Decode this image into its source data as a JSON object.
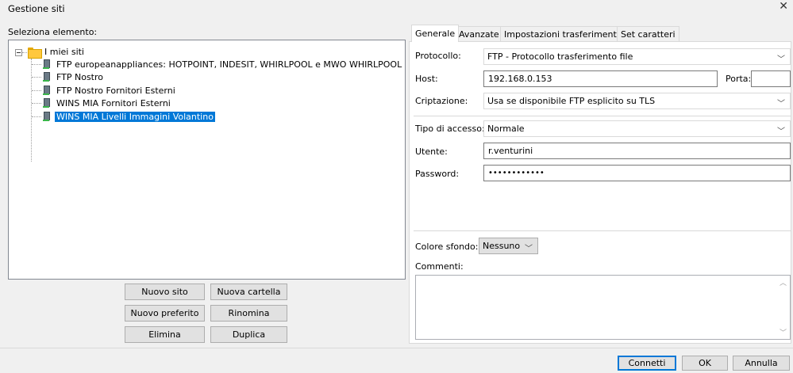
{
  "window": {
    "title": "Gestione siti",
    "close_glyph": "✕"
  },
  "tree": {
    "header": "Seleziona elemento:",
    "root_label": "I miei siti",
    "items": [
      {
        "label": "FTP europeanappliances: HOTPOINT, INDESIT, WHIRLPOOL e MWO WHIRLPOOL",
        "selected": false
      },
      {
        "label": "FTP Nostro",
        "selected": false
      },
      {
        "label": "FTP Nostro Fornitori Esterni",
        "selected": false
      },
      {
        "label": "WINS MIA Fornitori Esterni",
        "selected": false
      },
      {
        "label": "WINS MIA Livelli Immagini Volantino",
        "selected": true
      }
    ]
  },
  "buttons": {
    "new_site": "Nuovo sito",
    "new_folder": "Nuova cartella",
    "new_bookmark": "Nuovo preferito",
    "rename": "Rinomina",
    "delete": "Elimina",
    "duplicate": "Duplica"
  },
  "tabs": [
    {
      "label": "Generale",
      "active": true
    },
    {
      "label": "Avanzate",
      "active": false
    },
    {
      "label": "Impostazioni trasferimento",
      "active": false
    },
    {
      "label": "Set caratteri",
      "active": false
    }
  ],
  "general": {
    "protocol_label": "Protocollo:",
    "protocol_value": "FTP - Protocollo trasferimento file",
    "host_label": "Host:",
    "host_value": "192.168.0.153",
    "port_label": "Porta:",
    "port_value": "",
    "encryption_label": "Criptazione:",
    "encryption_value": "Usa se disponibile FTP esplicito su TLS",
    "logon_type_label": "Tipo di accesso:",
    "logon_type_value": "Normale",
    "user_label": "Utente:",
    "user_value": "r.venturini",
    "password_label": "Password:",
    "password_value": "••••••••••••",
    "bg_color_label": "Colore sfondo:",
    "bg_color_value": "Nessuno",
    "comments_label": "Commenti:",
    "comments_value": ""
  },
  "footer": {
    "connect": "Connetti",
    "ok": "OK",
    "cancel": "Annulla"
  },
  "icons": {
    "chevron": "chevron-down-icon",
    "folder": "folder-icon",
    "server": "server-icon"
  },
  "colors": {
    "selection": "#0078d7",
    "background": "#f0f0f0"
  }
}
